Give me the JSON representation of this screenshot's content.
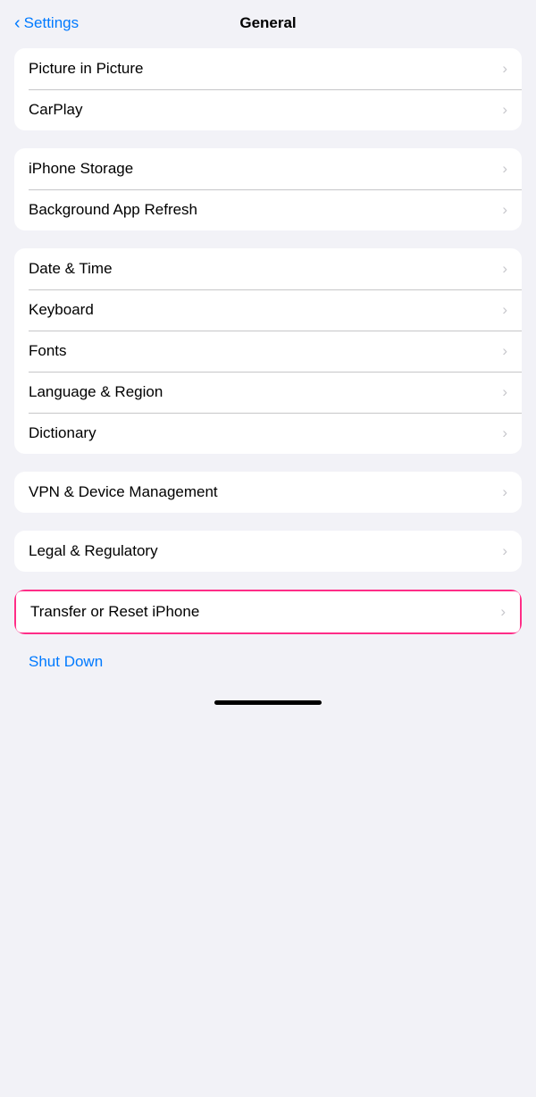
{
  "header": {
    "back_label": "Settings",
    "title": "General"
  },
  "groups": [
    {
      "id": "group1",
      "items": [
        {
          "id": "picture-in-picture",
          "label": "Picture in Picture"
        },
        {
          "id": "carplay",
          "label": "CarPlay"
        }
      ]
    },
    {
      "id": "group2",
      "items": [
        {
          "id": "iphone-storage",
          "label": "iPhone Storage"
        },
        {
          "id": "background-app-refresh",
          "label": "Background App Refresh"
        }
      ]
    },
    {
      "id": "group3",
      "items": [
        {
          "id": "date-time",
          "label": "Date & Time"
        },
        {
          "id": "keyboard",
          "label": "Keyboard"
        },
        {
          "id": "fonts",
          "label": "Fonts"
        },
        {
          "id": "language-region",
          "label": "Language & Region"
        },
        {
          "id": "dictionary",
          "label": "Dictionary"
        }
      ]
    },
    {
      "id": "group4",
      "items": [
        {
          "id": "vpn-device-management",
          "label": "VPN & Device Management"
        }
      ]
    },
    {
      "id": "group5",
      "items": [
        {
          "id": "legal-regulatory",
          "label": "Legal & Regulatory"
        }
      ]
    }
  ],
  "highlighted_item": {
    "id": "transfer-reset",
    "label": "Transfer or Reset iPhone"
  },
  "shutdown": {
    "label": "Shut Down"
  },
  "chevron": "›",
  "home_indicator": true
}
